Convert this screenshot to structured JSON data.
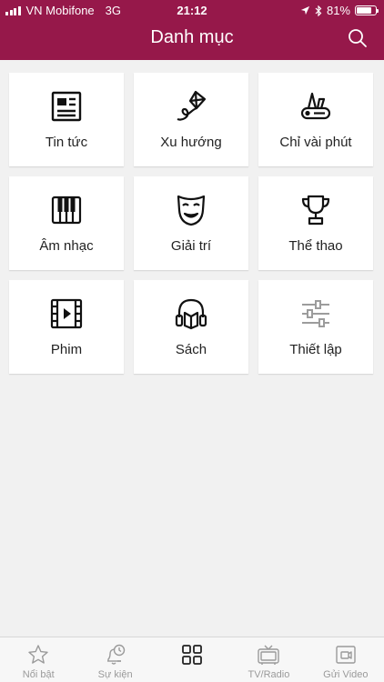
{
  "status": {
    "carrier": "VN Mobifone",
    "network": "3G",
    "time": "21:12",
    "battery": "81%",
    "battery_level": 0.81
  },
  "header": {
    "title": "Danh mục",
    "bg_color": "#96184a"
  },
  "categories": [
    {
      "label": "Tin tức",
      "icon": "news-icon"
    },
    {
      "label": "Xu hướng",
      "icon": "kite-icon"
    },
    {
      "label": "Chỉ vài phút",
      "icon": "pocket-knife-icon"
    },
    {
      "label": "Âm nhạc",
      "icon": "piano-icon"
    },
    {
      "label": "Giải trí",
      "icon": "mask-icon"
    },
    {
      "label": "Thể thao",
      "icon": "trophy-icon"
    },
    {
      "label": "Phim",
      "icon": "film-icon"
    },
    {
      "label": "Sách",
      "icon": "audiobook-icon"
    },
    {
      "label": "Thiết lập",
      "icon": "sliders-icon"
    }
  ],
  "tabs": [
    {
      "label": "Nổi bật",
      "icon": "star-icon",
      "active": false
    },
    {
      "label": "Sự kiện",
      "icon": "bell-clock-icon",
      "active": false
    },
    {
      "label": "",
      "icon": "grid-icon",
      "active": true
    },
    {
      "label": "TV/Radio",
      "icon": "tv-icon",
      "active": false
    },
    {
      "label": "Gửi Video",
      "icon": "send-video-icon",
      "active": false
    }
  ]
}
